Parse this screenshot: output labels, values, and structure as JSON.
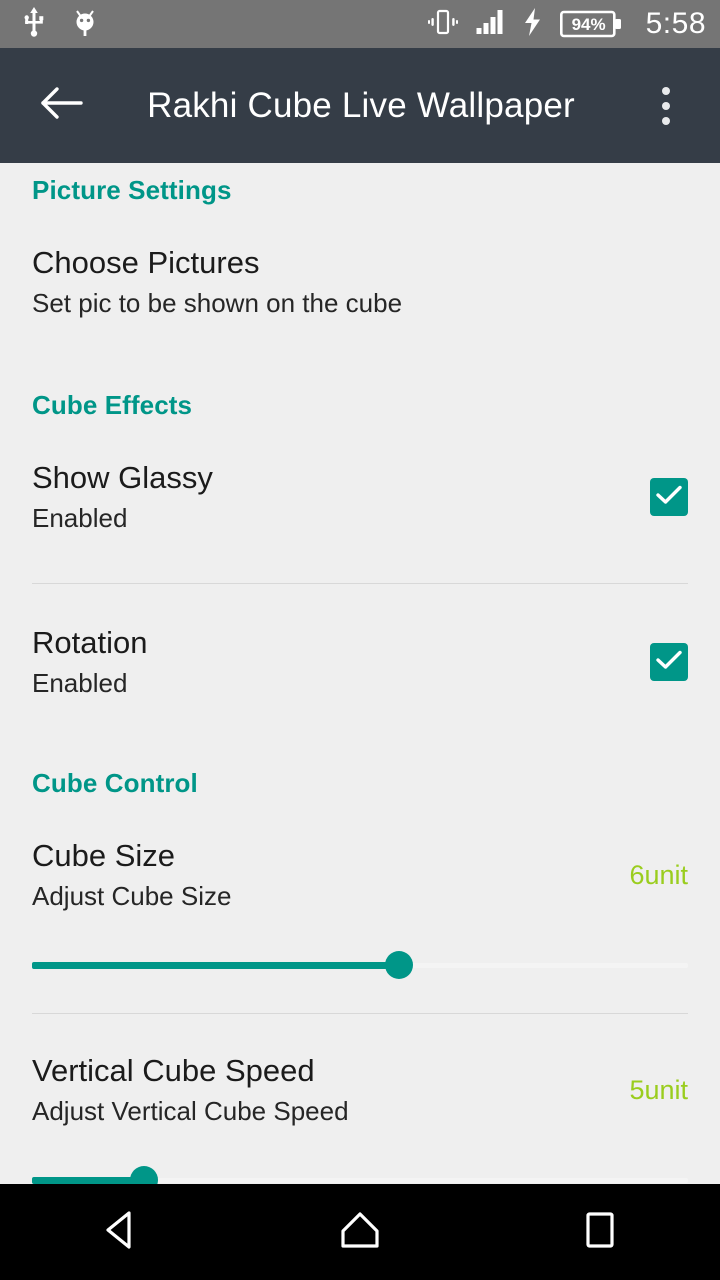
{
  "status_bar": {
    "background": "#757575",
    "icons": [
      "usb-icon",
      "android-debug-icon",
      "vibrate-icon",
      "signal-icon",
      "charging-bolt-icon"
    ],
    "battery_percent": "94%",
    "clock": "5:58"
  },
  "app_bar": {
    "background": "#353d47",
    "back_icon": "back-arrow-icon",
    "title": "Rakhi Cube Live Wallpaper",
    "overflow_icon": "overflow-menu-icon"
  },
  "accent": {
    "teal": "#009688",
    "value_green": "#9acd1e",
    "page_background": "#efefef"
  },
  "sections": [
    {
      "header": "Picture Settings",
      "items": [
        {
          "title": "Choose Pictures",
          "subtitle": "Set pic to be shown on the cube"
        }
      ]
    },
    {
      "header": "Cube Effects",
      "items": [
        {
          "title": "Show Glassy",
          "subtitle": "Enabled",
          "checked": true
        },
        {
          "title": "Rotation",
          "subtitle": "Enabled",
          "checked": true
        }
      ]
    },
    {
      "header": "Cube Control",
      "items": [
        {
          "title": "Cube Size",
          "subtitle": "Adjust Cube Size",
          "value": "6unit",
          "slider_percent": 56
        },
        {
          "title": "Vertical Cube Speed",
          "subtitle": "Adjust Vertical Cube Speed",
          "value": "5unit",
          "slider_percent": 17
        }
      ]
    }
  ],
  "nav_bar": {
    "background": "#000000",
    "buttons": [
      "back-nav-icon",
      "home-nav-icon",
      "recents-nav-icon"
    ]
  }
}
